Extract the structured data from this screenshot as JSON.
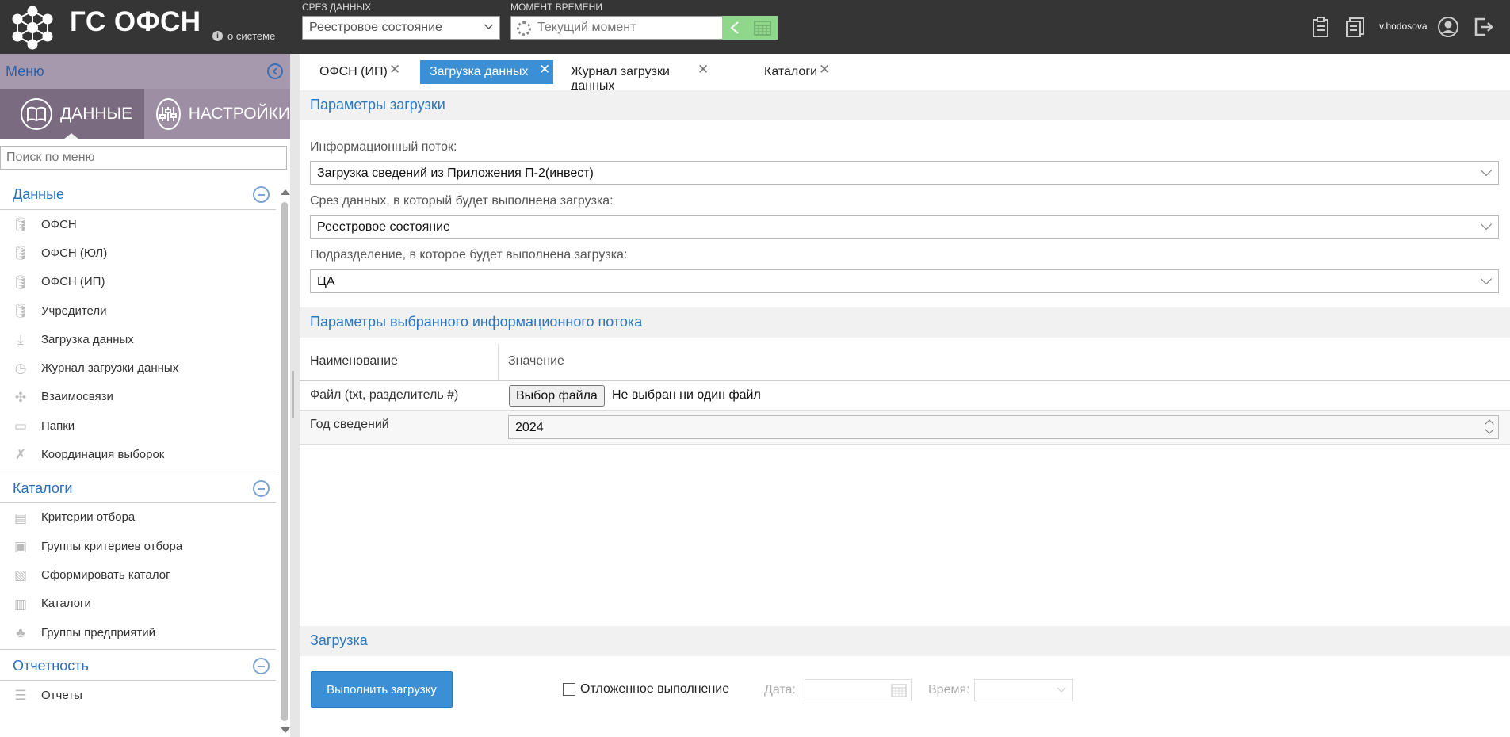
{
  "header": {
    "brand": "ГС ОФСН",
    "about": "о системе",
    "slice_label": "СРЕЗ ДАННЫХ",
    "slice_value": "Реестровое состояние",
    "moment_label": "МОМЕНТ ВРЕМЕНИ",
    "moment_value": "Текущий момент",
    "username": "v.hodosova"
  },
  "sidebar": {
    "menu_title": "Меню",
    "tab_data": "ДАННЫЕ",
    "tab_settings": "НАСТРОЙКИ",
    "search_placeholder": "Поиск по меню",
    "groups": [
      {
        "title": "Данные",
        "items": [
          "ОФСН",
          "ОФСН (ЮЛ)",
          "ОФСН (ИП)",
          "Учредители",
          "Загрузка данных",
          "Журнал загрузки данных",
          "Взаимосвязи",
          "Папки",
          "Координация выборок"
        ]
      },
      {
        "title": "Каталоги",
        "items": [
          "Критерии отбора",
          "Группы критериев отбора",
          "Сформировать каталог",
          "Каталоги",
          "Группы предприятий"
        ]
      },
      {
        "title": "Отчетность",
        "items": [
          "Отчеты"
        ]
      }
    ]
  },
  "tabs": [
    "ОФСН (ИП)",
    "Загрузка данных",
    "Журнал загрузки данных",
    "Каталоги"
  ],
  "active_tab": "Загрузка данных",
  "params": {
    "title": "Параметры загрузки",
    "stream_label": "Информационный поток:",
    "stream_value": "Загрузка сведений из Приложения П-2(инвест)",
    "slice_label": "Срез данных, в который будет выполнена загрузка:",
    "slice_value": "Реестровое состояние",
    "division_label": "Подразделение, в которое будет выполнена загрузка:",
    "division_value": "ЦА"
  },
  "stream_params": {
    "title": "Параметры выбранного информационного потока",
    "col_name": "Наименование",
    "col_value": "Значение",
    "rows": [
      {
        "name": "Файл (txt, разделитель #)",
        "button": "Выбор файла",
        "value": "Не выбран ни один файл"
      },
      {
        "name": "Год сведений",
        "value": "2024"
      }
    ]
  },
  "load": {
    "title": "Загрузка",
    "run_button": "Выполнить загрузку",
    "deferred": "Отложенное выполнение",
    "date_label": "Дата:",
    "time_label": "Время:"
  },
  "colors": {
    "accent": "#3b8fd4",
    "header_bg": "#353535",
    "sidebar_header": "#a799ad",
    "link": "#2a77c0",
    "moment_btn": "#8fd88b"
  }
}
